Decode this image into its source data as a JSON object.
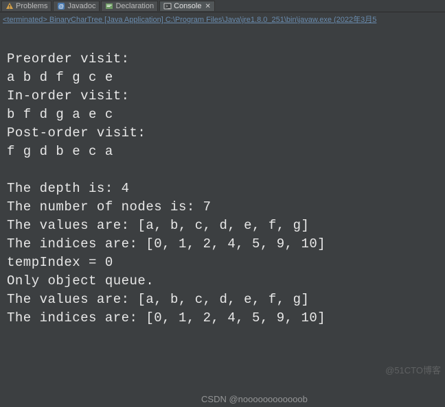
{
  "tabs": [
    {
      "label": "Problems",
      "icon": "warning-icon"
    },
    {
      "label": "Javadoc",
      "icon": "javadoc-icon"
    },
    {
      "label": "Declaration",
      "icon": "declaration-icon"
    },
    {
      "label": "Console",
      "icon": "console-icon",
      "active": true
    }
  ],
  "terminated_line": "<terminated> BinaryCharTree [Java Application] C:\\Program Files\\Java\\jre1.8.0_251\\bin\\javaw.exe (2022年3月5",
  "output_lines": [
    "",
    "Preorder visit:",
    "a b d f g c e ",
    "In-order visit:",
    "b f d g a e c ",
    "Post-order visit:",
    "f g d b e c a ",
    "",
    "The depth is: 4",
    "The number of nodes is: 7",
    "The values are: [a, b, c, d, e, f, g]",
    "The indices are: [0, 1, 2, 4, 5, 9, 10]",
    "tempIndex = 0",
    "Only object queue.",
    "The values are: [a, b, c, d, e, f, g]",
    "The indices are: [0, 1, 2, 4, 5, 9, 10]"
  ],
  "watermark_right": "@51CTO博客",
  "watermark_bottom": "CSDN @noooooooooooob"
}
